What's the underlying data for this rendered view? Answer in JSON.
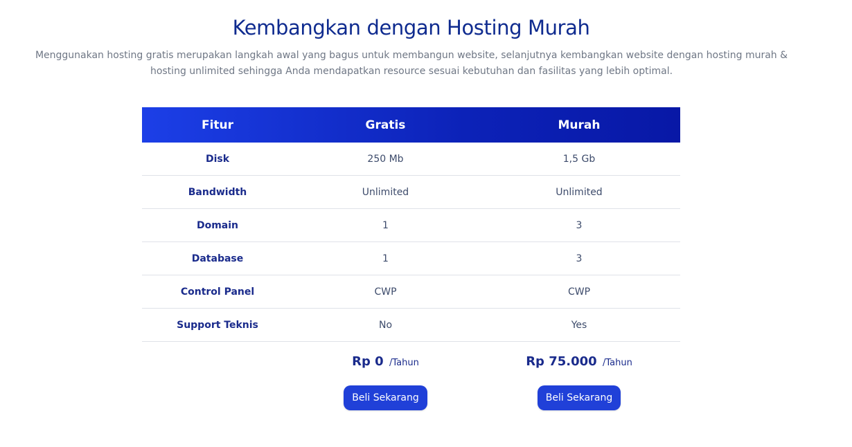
{
  "header": {
    "title": "Kembangkan dengan Hosting Murah",
    "subtitle": "Menggunakan hosting gratis merupakan langkah awal yang bagus untuk membangun website, selanjutnya kembangkan website dengan hosting murah & hosting unlimited sehingga Anda mendapatkan resource sesuai kebutuhan dan fasilitas yang lebih optimal."
  },
  "table": {
    "columns": [
      "Fitur",
      "Gratis",
      "Murah"
    ],
    "rows": [
      {
        "feature": "Disk",
        "gratis": "250 Mb",
        "murah": "1,5 Gb"
      },
      {
        "feature": "Bandwidth",
        "gratis": "Unlimited",
        "murah": "Unlimited"
      },
      {
        "feature": "Domain",
        "gratis": "1",
        "murah": "3"
      },
      {
        "feature": "Database",
        "gratis": "1",
        "murah": "3"
      },
      {
        "feature": "Control Panel",
        "gratis": "CWP",
        "murah": "CWP"
      },
      {
        "feature": "Support Teknis",
        "gratis": "No",
        "murah": "Yes"
      }
    ],
    "prices": {
      "gratis": {
        "amount": "Rp 0",
        "period": "/Tahun"
      },
      "murah": {
        "amount": "Rp 75.000",
        "period": "/Tahun"
      }
    },
    "buttons": {
      "gratis": "Beli Sekarang",
      "murah": "Beli Sekarang"
    }
  },
  "colors": {
    "heading": "#0f2b8f",
    "header_gradient_start": "#1c3fe7",
    "header_gradient_end": "#0818a6",
    "button": "#2040d8"
  }
}
